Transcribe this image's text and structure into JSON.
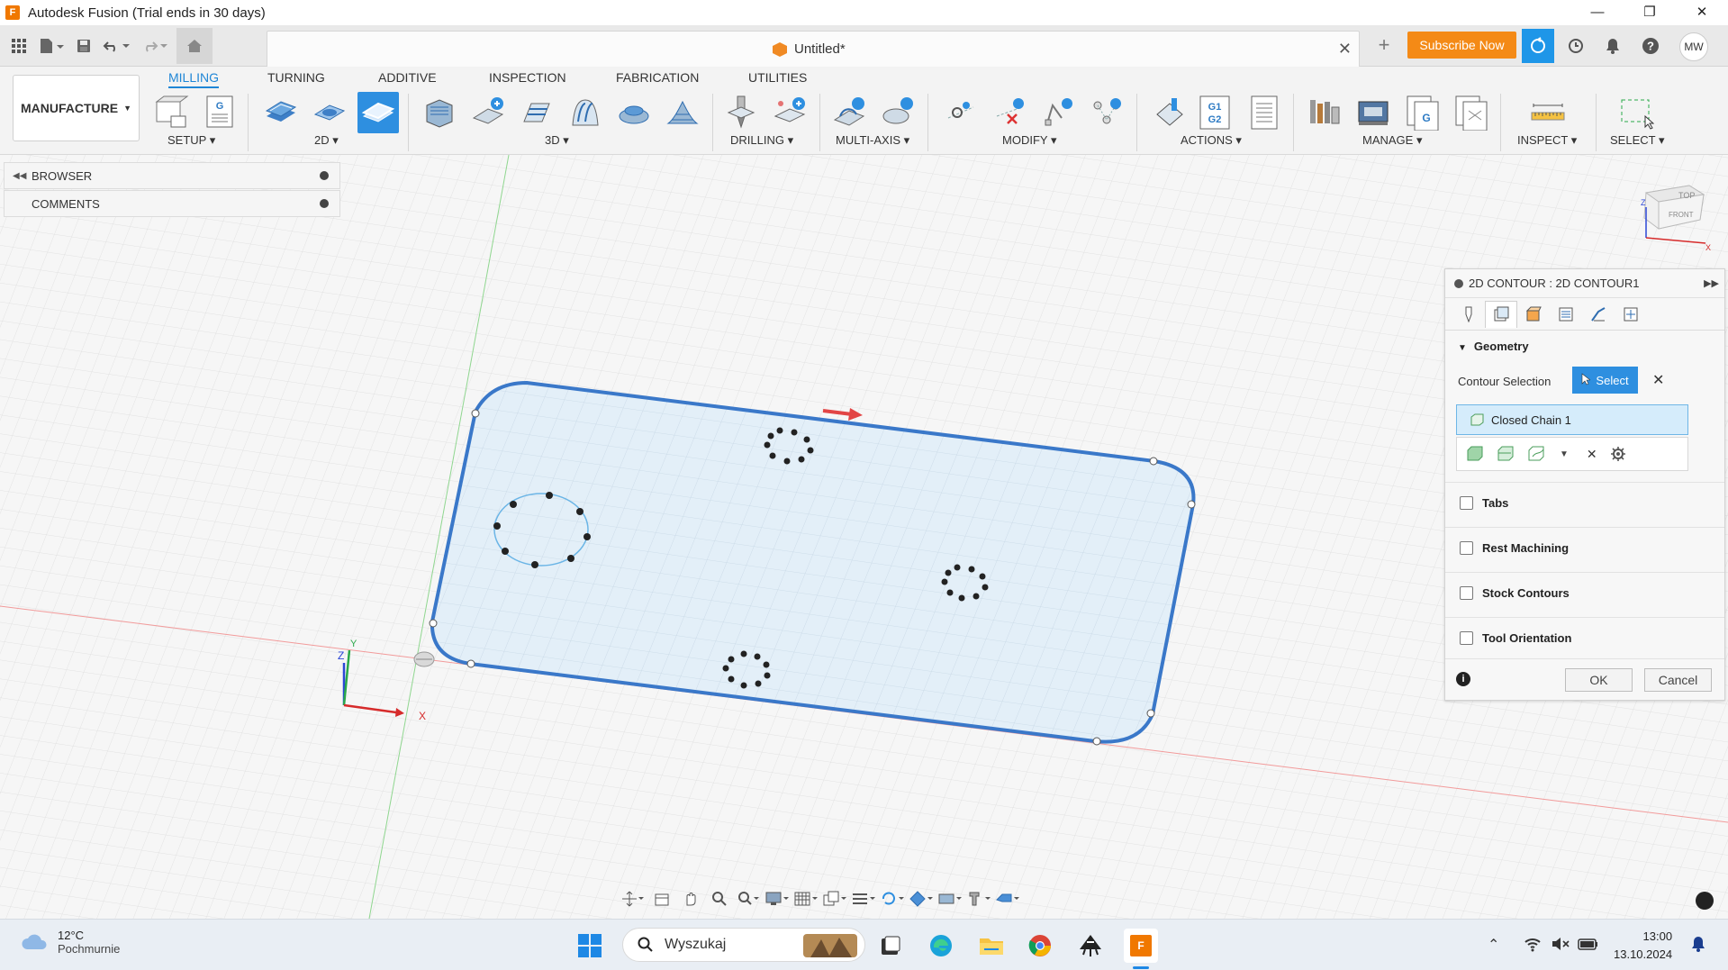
{
  "window": {
    "title": "Autodesk Fusion (Trial ends in 30 days)",
    "logo_letter": "F"
  },
  "appbar": {
    "document_name": "Untitled*",
    "subscribe_label": "Subscribe Now",
    "user_initials": "MW"
  },
  "ribbon": {
    "workspace_label": "MANUFACTURE",
    "tabs": [
      "MILLING",
      "TURNING",
      "ADDITIVE",
      "INSPECTION",
      "FABRICATION",
      "UTILITIES"
    ],
    "active_tab": "MILLING",
    "groups": [
      "SETUP",
      "2D",
      "3D",
      "DRILLING",
      "MULTI-AXIS",
      "MODIFY",
      "ACTIONS",
      "MANAGE",
      "INSPECT",
      "SELECT"
    ],
    "g1g2_text": [
      "G1",
      "G2"
    ]
  },
  "browser": {
    "items": [
      "BROWSER",
      "COMMENTS"
    ]
  },
  "viewcube": {
    "top": "TOP",
    "front": "FRONT"
  },
  "triad": {
    "x": "X",
    "y": "Y",
    "z": "Z"
  },
  "dialog": {
    "title": "2D CONTOUR : 2D CONTOUR1",
    "section": "Geometry",
    "contour_selection_label": "Contour Selection",
    "select_label": "Select",
    "chain_item": "Closed Chain 1",
    "options": [
      "Tabs",
      "Rest Machining",
      "Stock Contours",
      "Tool Orientation"
    ],
    "ok_label": "OK",
    "cancel_label": "Cancel"
  },
  "taskbar": {
    "temperature": "12°C",
    "weather": "Pochmurnie",
    "search_placeholder": "Wyszukaj",
    "time": "13:00",
    "date": "13.10.2024"
  },
  "colors": {
    "accent": "#2e8fe0",
    "subscribe": "#f48a16",
    "contour": "#3a78c9",
    "fill": "#e2eff8"
  }
}
